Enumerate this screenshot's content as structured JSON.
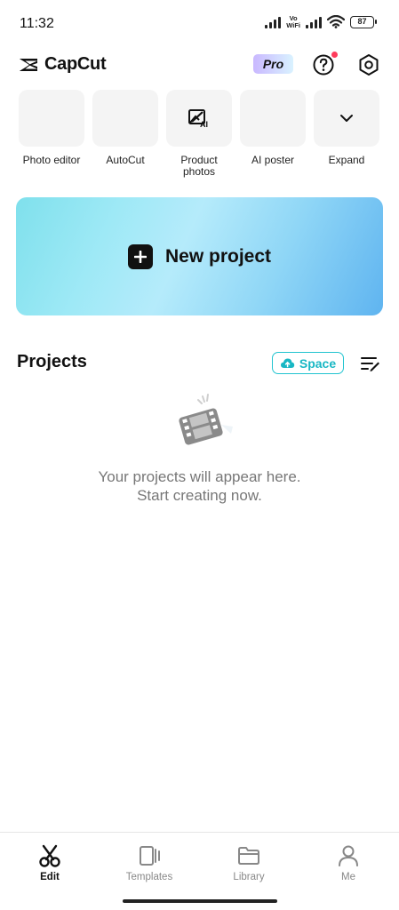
{
  "status_bar": {
    "time": "11:32",
    "vowifi_top": "Vo",
    "vowifi_bottom": "WiFi",
    "battery": "87"
  },
  "header": {
    "logo_text": "CapCut",
    "pro_label": "Pro",
    "help_icon": "help-circle-icon",
    "settings_icon": "settings-hexagon-icon",
    "notification_dot_color": "#ff3b5c"
  },
  "tools": [
    {
      "label": "Photo editor",
      "icon": ""
    },
    {
      "label": "AutoCut",
      "icon": ""
    },
    {
      "label": "Product photos",
      "icon": "ai-image-icon"
    },
    {
      "label": "AI poster",
      "icon": ""
    },
    {
      "label": "Expand",
      "icon": "chevron-down-icon"
    }
  ],
  "new_project": {
    "label": "New project",
    "icon": "plus-icon"
  },
  "projects": {
    "title": "Projects",
    "space_label": "Space",
    "space_color": "#22c4d0",
    "empty_line1": "Your projects will appear here.",
    "empty_line2": "Start creating now."
  },
  "bottom_nav": [
    {
      "label": "Edit",
      "icon": "scissors-icon",
      "active": true
    },
    {
      "label": "Templates",
      "icon": "templates-icon",
      "active": false
    },
    {
      "label": "Library",
      "icon": "folder-icon",
      "active": false
    },
    {
      "label": "Me",
      "icon": "person-icon",
      "active": false
    }
  ]
}
